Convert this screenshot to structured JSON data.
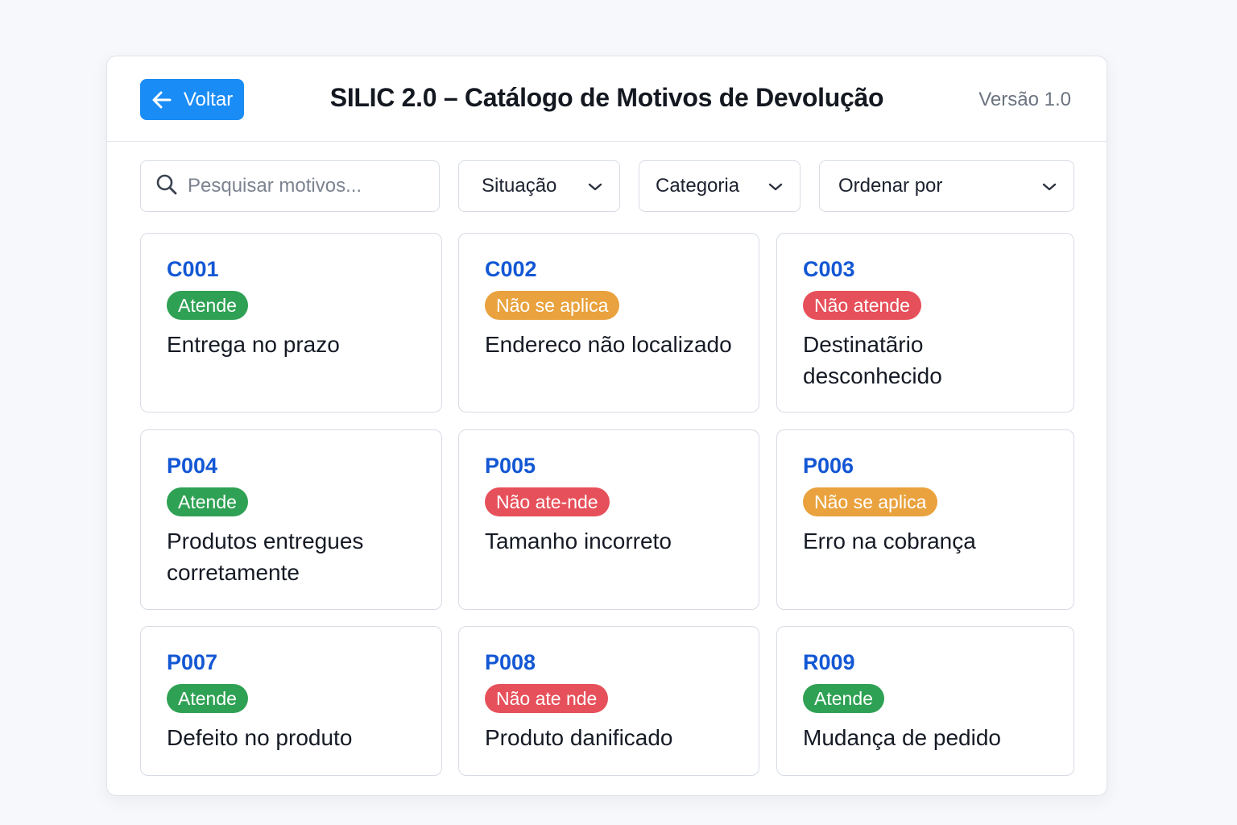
{
  "header": {
    "back_label": "Voltar",
    "title": "SILIC 2.0 – Catálogo de Motivos de Devolução",
    "version": "Versão 1.0"
  },
  "filters": {
    "search_placeholder": "Pesquisar motivos...",
    "situacao": "Situação",
    "categoria": "Categoria",
    "ordenar": "Ordenar por"
  },
  "colors": {
    "accent": "#1a8cf5",
    "code": "#1357d4",
    "status_atende": "#2fa154",
    "status_nao_se_aplica": "#e9a23d",
    "status_nao_atende": "#e6505a"
  },
  "cards": [
    {
      "code": "C001",
      "status": "Atende",
      "reason": "Entrega no prazo"
    },
    {
      "code": "C002",
      "status": "Não se aplica",
      "reason": "Endereco não localizado"
    },
    {
      "code": "C003",
      "status": "Não atende",
      "reason": "Destinatãrio desconhecido"
    },
    {
      "code": "P004",
      "status": "Atende",
      "reason": "Produtos entregues corretamente"
    },
    {
      "code": "P005",
      "status": "Não ate-nde",
      "reason": "Tamanho incorreto"
    },
    {
      "code": "P006",
      "status": "Não se aplica",
      "reason": "Erro na cobrança"
    },
    {
      "code": "P007",
      "status": "Atende",
      "reason": "Defeito no  produto"
    },
    {
      "code": "P008",
      "status": "Não ate nde",
      "reason": "Produto danificado"
    },
    {
      "code": "R009",
      "status": "Atende",
      "reason": "Mudança de pedido"
    }
  ]
}
